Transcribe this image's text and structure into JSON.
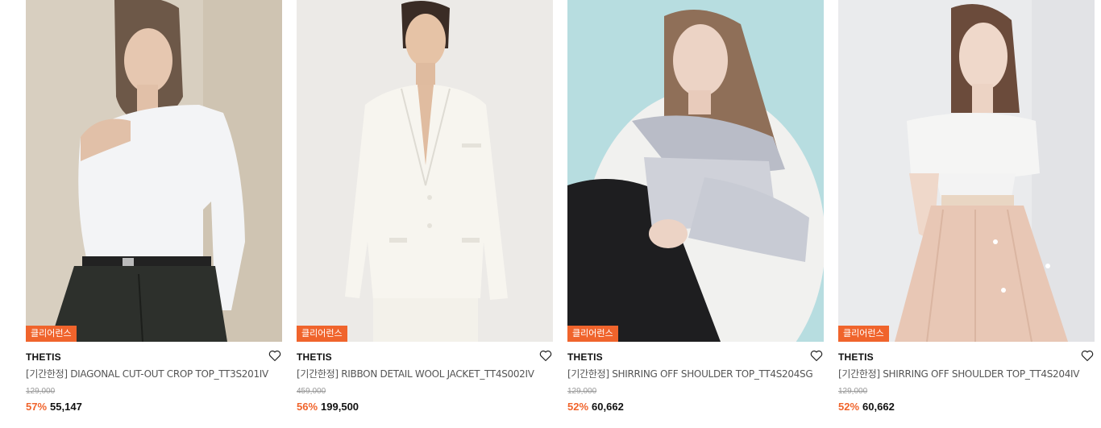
{
  "products": [
    {
      "badge": "클리어런스",
      "brand": "THETIS",
      "name": "[기간한정] DIAGONAL CUT-OUT CROP TOP_TT3S201IV",
      "original_price": "129,000",
      "discount": "57%",
      "sale_price": "55,147",
      "wishlist_icon": "heart-outline-icon"
    },
    {
      "badge": "클리어런스",
      "brand": "THETIS",
      "name": "[기간한정] RIBBON DETAIL WOOL JACKET_TT4S002IV",
      "original_price": "459,000",
      "discount": "56%",
      "sale_price": "199,500",
      "wishlist_icon": "heart-outline-icon"
    },
    {
      "badge": "클리어런스",
      "brand": "THETIS",
      "name": "[기간한정] SHIRRING OFF SHOULDER TOP_TT4S204SG",
      "original_price": "129,000",
      "discount": "52%",
      "sale_price": "60,662",
      "wishlist_icon": "heart-outline-icon"
    },
    {
      "badge": "클리어런스",
      "brand": "THETIS",
      "name": "[기간한정] SHIRRING OFF SHOULDER TOP_TT4S204IV",
      "original_price": "129,000",
      "discount": "52%",
      "sale_price": "60,662",
      "wishlist_icon": "heart-outline-icon"
    }
  ],
  "colors": {
    "accent": "#f0642c",
    "text": "#111111",
    "muted": "#999999"
  }
}
